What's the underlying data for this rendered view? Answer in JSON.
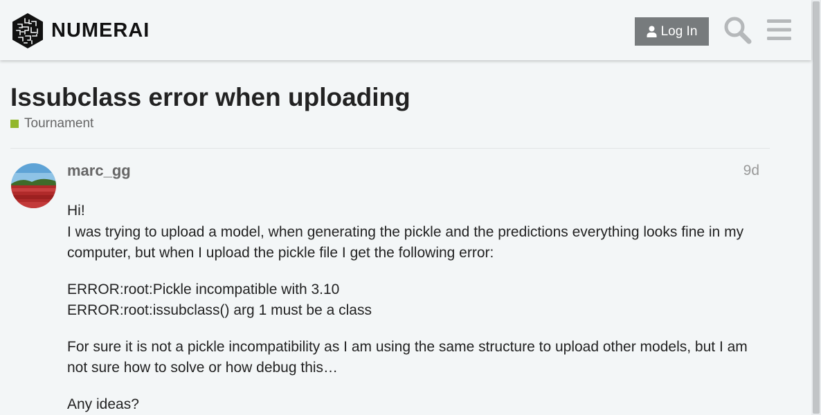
{
  "header": {
    "brand": "NUMERAI",
    "login_label": "Log In",
    "icons": [
      "user-icon",
      "search-icon",
      "hamburger-menu-icon"
    ]
  },
  "topic": {
    "title": "Issubclass error when uploading",
    "category": "Tournament",
    "category_color": "#92b72c"
  },
  "post": {
    "username": "marc_gg",
    "date": "9d",
    "lines": {
      "p1a": "Hi!",
      "p1b": "I was trying to upload a model, when generating the pickle and the predictions everything looks fine in my computer, but when I upload the pickle file I get the following error:",
      "p2a": "ERROR:root:Pickle incompatible with 3.10",
      "p2b": "ERROR:root:issubclass() arg 1 must be a class",
      "p3": "For sure it is not a pickle incompatibility as I am using the same structure to upload other models, but I am not sure how to solve or how debug this…",
      "p4": "Any ideas?"
    }
  },
  "colors": {
    "background": "#f3f6f7",
    "button": "#777b7d",
    "icon_gray": "#b5b8ba"
  }
}
